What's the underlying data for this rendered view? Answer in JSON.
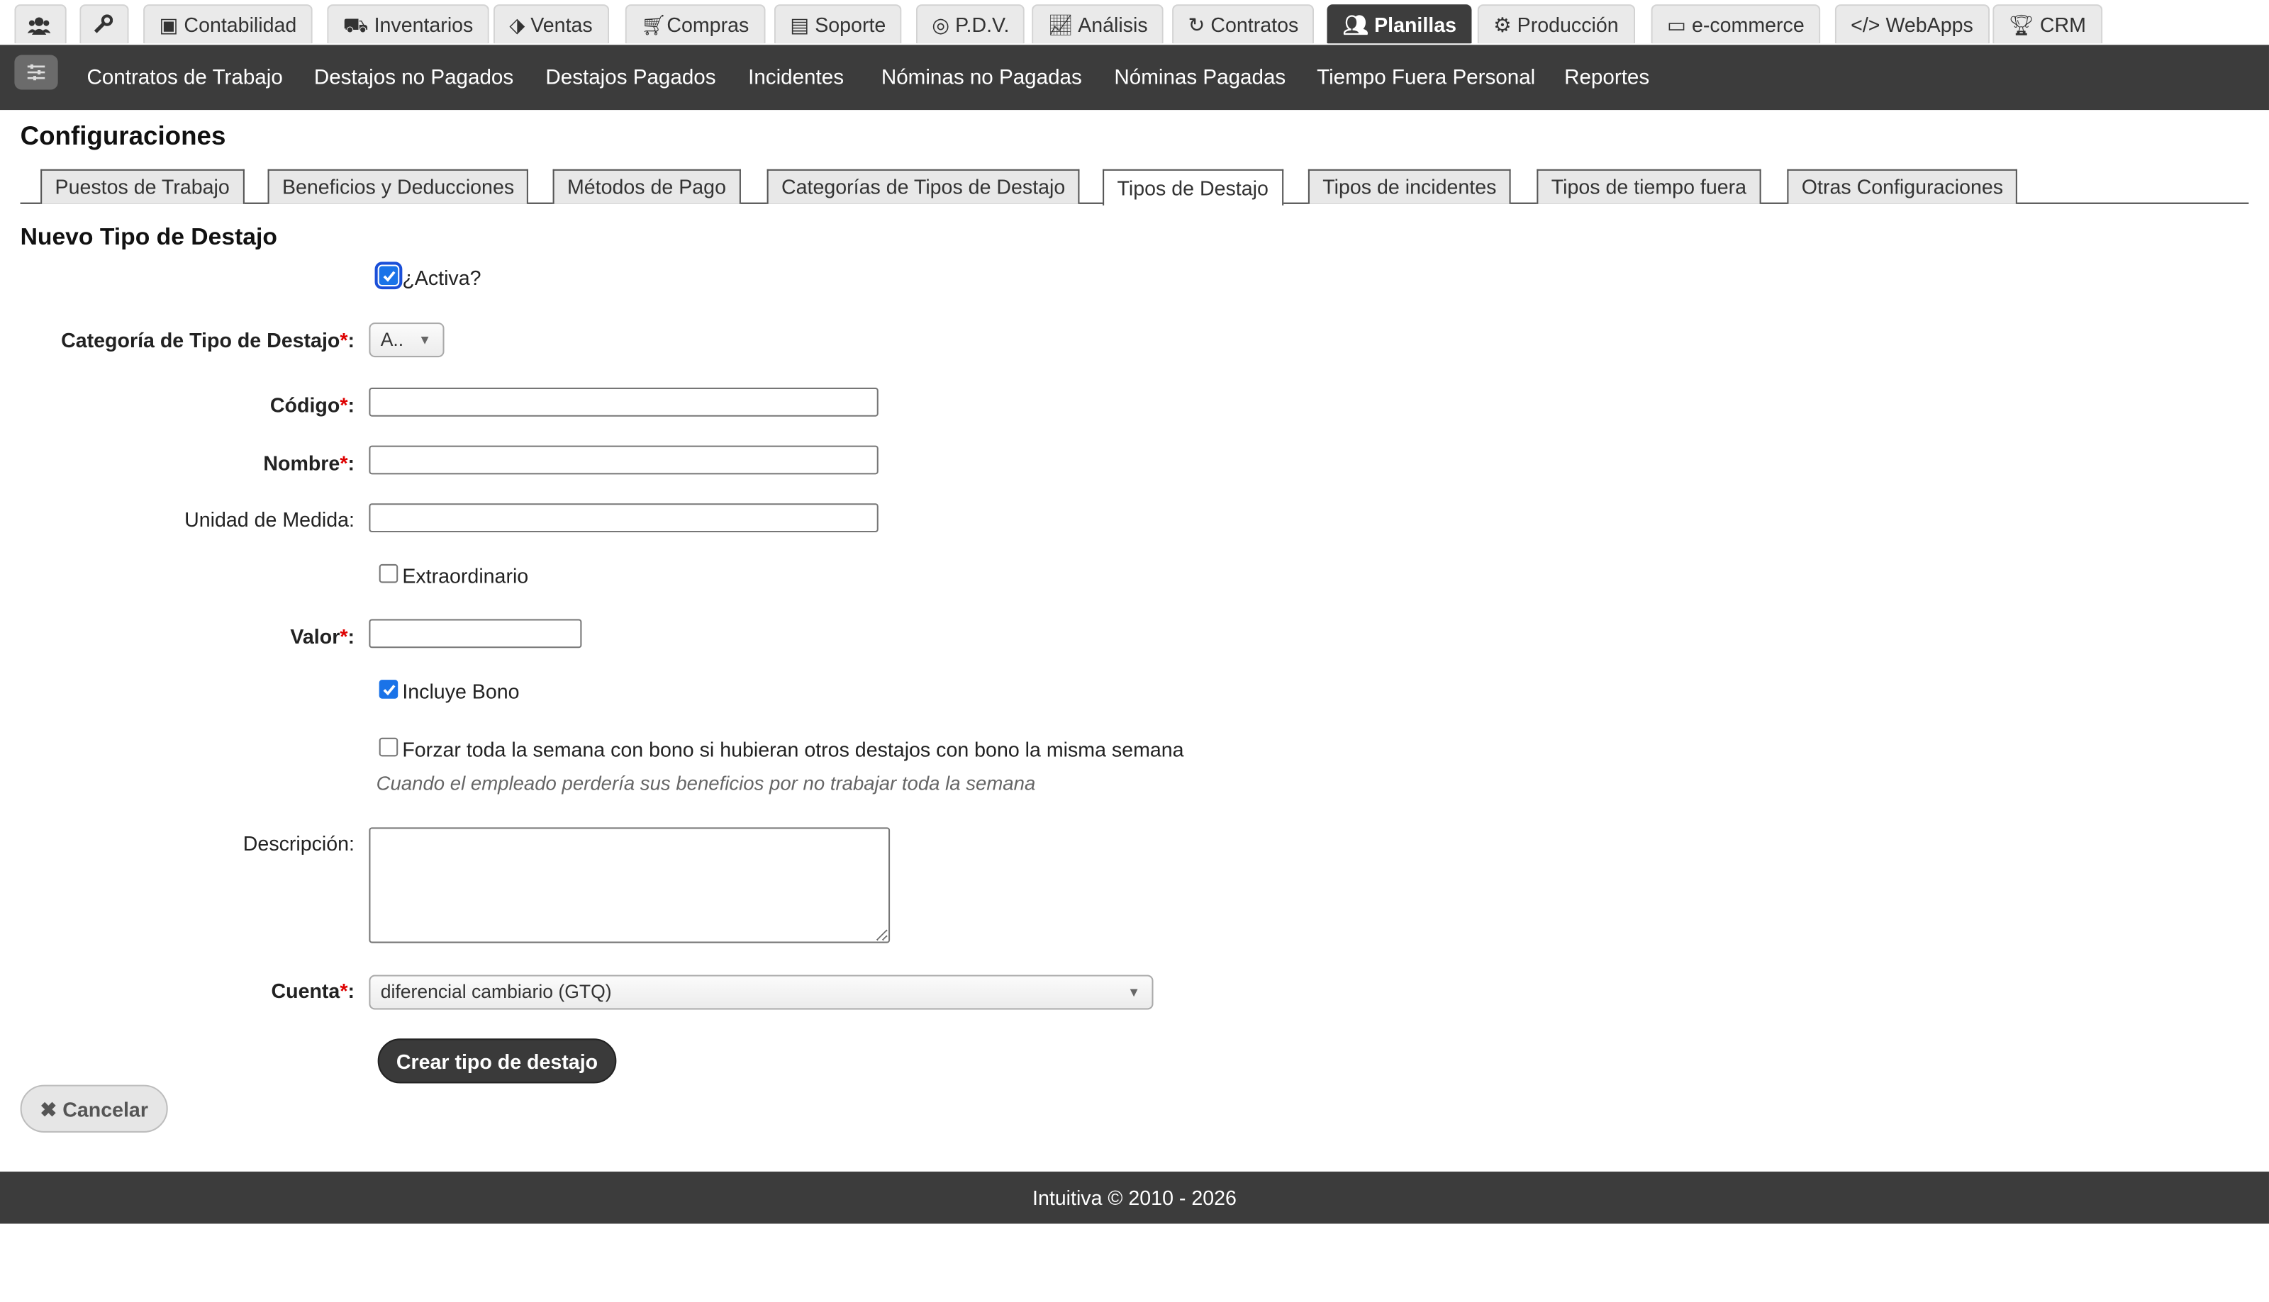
{
  "top_tabs": [
    {
      "label": "",
      "icon": "users-icon"
    },
    {
      "label": "",
      "icon": "wrench-icon"
    },
    {
      "label": "Contabilidad",
      "icon": "money-icon"
    },
    {
      "label": "Inventarios",
      "icon": "truck-icon"
    },
    {
      "label": "Ventas",
      "icon": "tags-icon"
    },
    {
      "label": "Compras",
      "icon": "cart-icon"
    },
    {
      "label": "Soporte",
      "icon": "support-icon"
    },
    {
      "label": "P.D.V.",
      "icon": "target-icon"
    },
    {
      "label": "Análisis",
      "icon": "chart-line-icon"
    },
    {
      "label": "Contratos",
      "icon": "refresh-icon"
    },
    {
      "label": "Planillas",
      "icon": "users-icon",
      "active": true
    },
    {
      "label": "Producción",
      "icon": "cogs-icon"
    },
    {
      "label": "e-commerce",
      "icon": "card-icon"
    },
    {
      "label": "WebApps",
      "icon": "code-icon"
    },
    {
      "label": "CRM",
      "icon": "trophy-icon"
    }
  ],
  "subnav": {
    "menu_icon": "sliders-icon",
    "items": [
      "Contratos de Trabajo",
      "Destajos no Pagados",
      "Destajos Pagados",
      "Incidentes",
      "Nóminas no Pagadas",
      "Nóminas Pagadas",
      "Tiempo Fuera Personal",
      "Reportes"
    ]
  },
  "page_title": "Configuraciones",
  "config_tabs": [
    "Puestos de Trabajo",
    "Beneficios y Deducciones",
    "Métodos de Pago",
    "Categorías de Tipos de Destajo",
    "Tipos de Destajo",
    "Tipos de incidentes",
    "Tipos de tiempo fuera",
    "Otras Configuraciones"
  ],
  "active_config_tab": "Tipos de Destajo",
  "form": {
    "title": "Nuevo Tipo de Destajo",
    "activa": {
      "label": "¿Activa?",
      "checked": true
    },
    "categoria": {
      "label": "Categoría de Tipo de Destajo",
      "value": "A.."
    },
    "codigo": {
      "label": "Código",
      "value": ""
    },
    "nombre": {
      "label": "Nombre",
      "value": ""
    },
    "unidad": {
      "label": "Unidad de Medida:",
      "value": ""
    },
    "extraordinario": {
      "label": "Extraordinario",
      "checked": false
    },
    "valor": {
      "label": "Valor",
      "value": ""
    },
    "incluye_bono": {
      "label": "Incluye Bono",
      "checked": true
    },
    "forzar": {
      "label": "Forzar toda la semana con bono si hubieran otros destajos con bono la misma semana",
      "checked": false
    },
    "forzar_hint": "Cuando el empleado perdería sus beneficios por no trabajar toda la semana",
    "descripcion": {
      "label": "Descripción:",
      "value": ""
    },
    "cuenta": {
      "label": "Cuenta",
      "value": "diferencial cambiario (GTQ)"
    },
    "required_mark": "*",
    "colon": ":",
    "submit_label": "Crear tipo de destajo",
    "cancel_label": "Cancelar"
  },
  "footer": "Intuitiva © 2010 - 2026",
  "colors": {
    "dark_bar": "#3c3c3c",
    "required": "#dd0000",
    "checkbox": "#1a73e8"
  }
}
